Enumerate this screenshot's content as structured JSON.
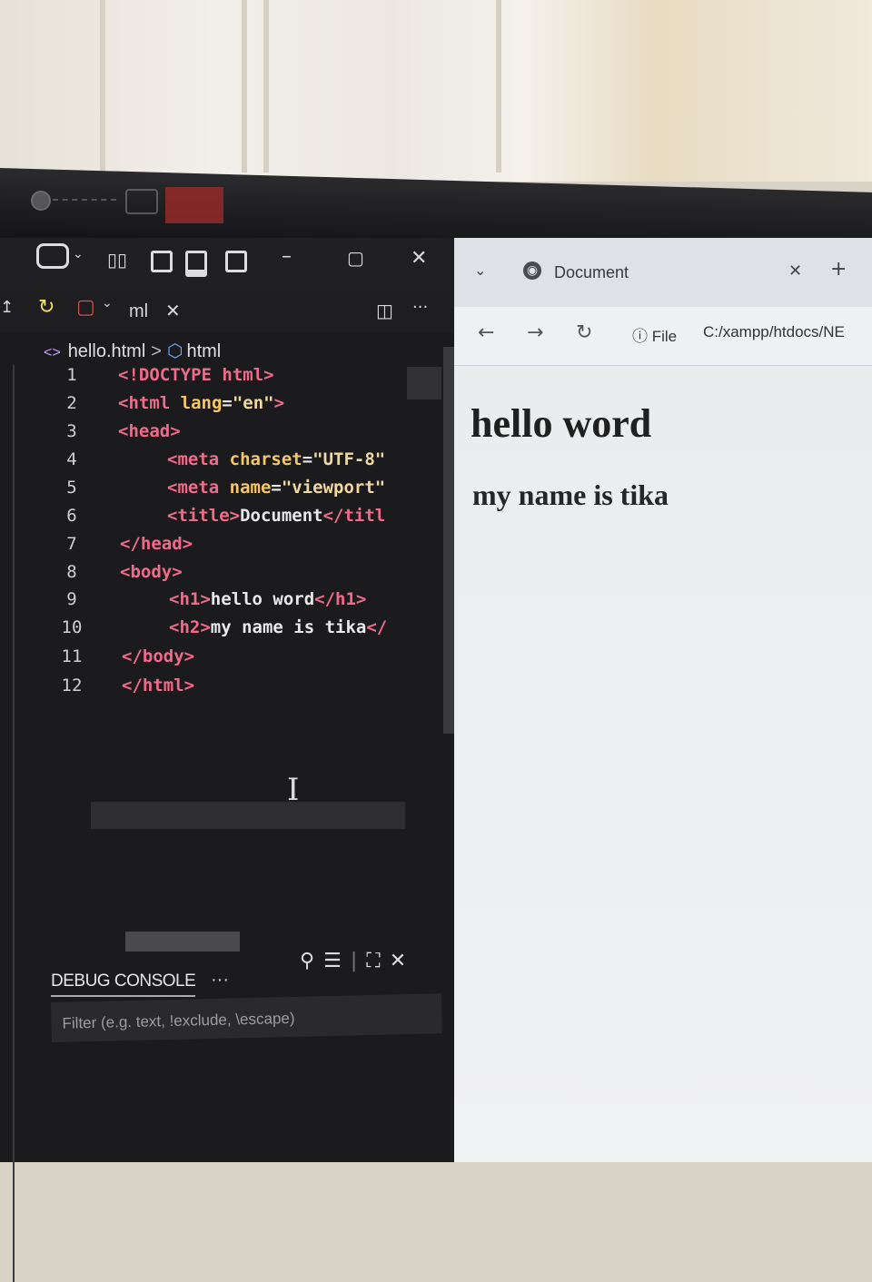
{
  "vscode": {
    "tab_label": "ml",
    "breadcrumb": {
      "file": "hello.html",
      "symbol": "html"
    },
    "lines": [
      {
        "n": "1",
        "parts": [
          [
            "t",
            "<!DOCTYPE html>"
          ]
        ]
      },
      {
        "n": "2",
        "parts": [
          [
            "t",
            "<html "
          ],
          [
            "a",
            "lang"
          ],
          [
            "p",
            "="
          ],
          [
            "s",
            "\"en\""
          ],
          [
            "t",
            ">"
          ]
        ]
      },
      {
        "n": "3",
        "parts": [
          [
            "t",
            "<head>"
          ]
        ]
      },
      {
        "n": "4",
        "parts": [
          [
            "t",
            "<meta "
          ],
          [
            "a",
            "charset"
          ],
          [
            "p",
            "="
          ],
          [
            "s",
            "\"UTF-8\""
          ]
        ]
      },
      {
        "n": "5",
        "parts": [
          [
            "t",
            "<meta "
          ],
          [
            "a",
            "name"
          ],
          [
            "p",
            "="
          ],
          [
            "s",
            "\"viewport\""
          ]
        ]
      },
      {
        "n": "6",
        "parts": [
          [
            "t",
            "<title>"
          ],
          [
            "p",
            "Document"
          ],
          [
            "t",
            "</titl"
          ]
        ]
      },
      {
        "n": "7",
        "parts": [
          [
            "t",
            "</head>"
          ]
        ]
      },
      {
        "n": "8",
        "parts": [
          [
            "t",
            "<body>"
          ]
        ]
      },
      {
        "n": "9",
        "parts": [
          [
            "t",
            "<h1>"
          ],
          [
            "p",
            "hello word"
          ],
          [
            "t",
            "</h1>"
          ]
        ]
      },
      {
        "n": "10",
        "parts": [
          [
            "t",
            "<h2>"
          ],
          [
            "p",
            "my name is tika"
          ],
          [
            "t",
            "</"
          ]
        ]
      },
      {
        "n": "11",
        "parts": [
          [
            "t",
            "</body>"
          ]
        ]
      },
      {
        "n": "12",
        "parts": [
          [
            "t",
            "</html>"
          ]
        ]
      }
    ],
    "panel": {
      "tab": "DEBUG CONSOLE",
      "more": "···",
      "filter_placeholder": "Filter (e.g. text, !exclude, \\escape)"
    }
  },
  "browser": {
    "tab_title": "Document",
    "address_info": "File",
    "address_url": "C:/xampp/htdocs/NE",
    "page": {
      "h1": "hello word",
      "h2": "my name is tika"
    }
  },
  "colors": {
    "tag": "#f06a8a",
    "attr": "#f6c768",
    "string": "#f0d9a0",
    "editor_bg": "#1b1b1d"
  }
}
